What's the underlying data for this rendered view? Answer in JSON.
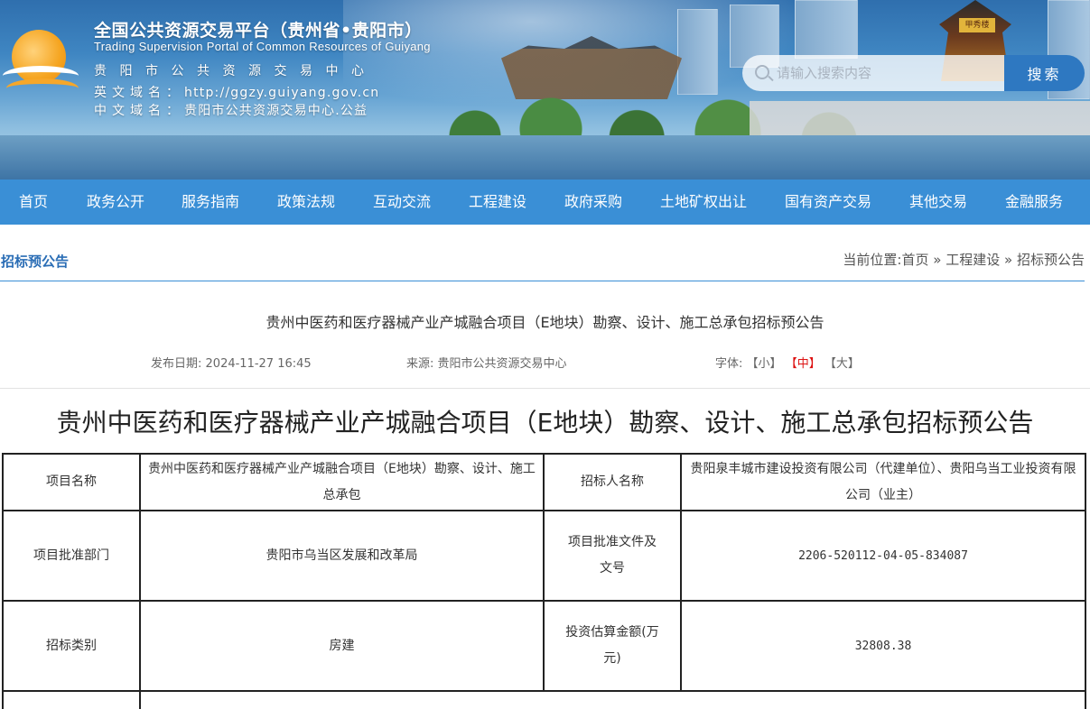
{
  "header": {
    "title": "全国公共资源交易平台（贵州省•贵阳市）",
    "subtitle_en": "Trading Supervision Portal of Common Resources of Guiyang",
    "center_name": "贵阳市公共资源交易中心",
    "domain_en_label": "英文域名：",
    "domain_en_value": "http://ggzy.guiyang.gov.cn",
    "domain_cn_label": "中文域名：",
    "domain_cn_value": "贵阳市公共资源交易中心.公益",
    "search_placeholder": "请输入搜索内容",
    "search_button": "搜索"
  },
  "nav": {
    "items": [
      "首页",
      "政务公开",
      "服务指南",
      "政策法规",
      "互动交流",
      "工程建设",
      "政府采购",
      "土地矿权出让",
      "国有资产交易",
      "其他交易",
      "金融服务"
    ]
  },
  "section": {
    "title": "招标预公告",
    "breadcrumb_prefix": "当前位置:",
    "breadcrumb": [
      "首页",
      "工程建设",
      "招标预公告"
    ],
    "separator": "»"
  },
  "article": {
    "title": "贵州中医药和医疗器械产业产城融合项目（E地块）勘察、设计、施工总承包招标预公告",
    "date_label": "发布日期:",
    "date_value": "2024-11-27 16:45",
    "source_label": "来源:",
    "source_value": "贵阳市公共资源交易中心",
    "font_label": "字体:",
    "font_small": "【小】",
    "font_medium": "【中】",
    "font_large": "【大】",
    "heading": "贵州中医药和医疗器械产业产城融合项目（E地块）勘察、设计、施工总承包招标预公告"
  },
  "table": {
    "rows": [
      {
        "label1": "项目名称",
        "value1": "贵州中医药和医疗器械产业产城融合项目（E地块）勘察、设计、施工总承包",
        "label2": "招标人名称",
        "value2": "贵阳泉丰城市建设投资有限公司（代建单位）、贵阳乌当工业投资有限公司（业主）"
      },
      {
        "label1": "项目批准部门",
        "value1": "贵阳市乌当区发展和改革局",
        "label2": "项目批准文件及文号",
        "value2": "2206-520112-04-05-834087"
      },
      {
        "label1": "招标类别",
        "value1": "房建",
        "label2": "投资估算金额(万元)",
        "value2": "32808.38"
      }
    ]
  },
  "colors": {
    "nav_bg": "#3a8fd6",
    "section_title": "#2a6db5",
    "search_button_bg": "#2e78c1",
    "active_font_size": "#dd1111"
  }
}
